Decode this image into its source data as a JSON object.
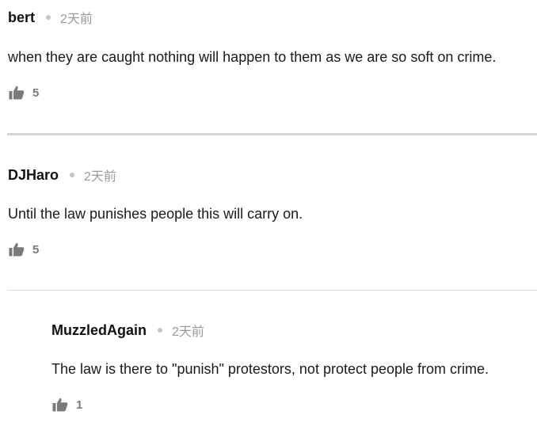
{
  "comments": [
    {
      "author": "bert",
      "time": "2天前",
      "text": "when they are caught nothing will happen to them as we are so soft on crime.",
      "likes": "5"
    },
    {
      "author": "DJHaro",
      "time": "2天前",
      "text": "Until the law punishes people this will carry on.",
      "likes": "5"
    },
    {
      "author": "MuzzledAgain",
      "time": "2天前",
      "text": "The law is there to \"punish\" protestors, not protect people from crime.",
      "likes": "1"
    }
  ],
  "icons": {
    "like": "thumbs-up-icon"
  },
  "colors": {
    "author": "#111111",
    "timestamp": "#9a9a9a",
    "like": "#7a7a7a",
    "divider": "#d6d6d6"
  }
}
